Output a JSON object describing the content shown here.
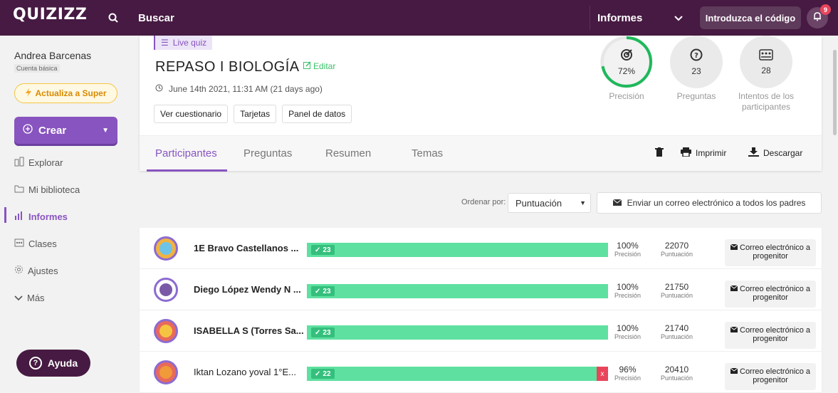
{
  "topbar": {
    "logo": "QUIZIZZ",
    "search_label": "Buscar",
    "reports_label": "Informes",
    "enter_code_label": "Introduzca el código",
    "notification_count": "9"
  },
  "sidebar": {
    "user_name": "Andrea Barcenas",
    "user_plan": "Cuenta básica",
    "upgrade_label": "Actualiza a Super",
    "create_label": "Crear",
    "items": [
      {
        "label": "Explorar",
        "icon": "explore-icon"
      },
      {
        "label": "Mi biblioteca",
        "icon": "folder-icon"
      },
      {
        "label": "Informes",
        "icon": "reports-icon",
        "active": true
      },
      {
        "label": "Clases",
        "icon": "classes-icon"
      },
      {
        "label": "Ajustes",
        "icon": "settings-icon"
      },
      {
        "label": "Más",
        "icon": "chevron-down-icon"
      }
    ],
    "help_label": "Ayuda"
  },
  "quiz": {
    "type_label": "Live quiz",
    "title": "REPASO I BIOLOGÍA",
    "edit_label": "Editar",
    "date": "June 14th 2021, 11:31 AM (21 days ago)",
    "buttons": [
      "Ver cuestionario",
      "Tarjetas",
      "Panel de datos"
    ],
    "stats": {
      "accuracy_value": "72%",
      "accuracy_label": "Precisión",
      "accuracy_fraction": 0.72,
      "questions_value": "23",
      "questions_label": "Preguntas",
      "attempts_value": "28",
      "attempts_label": "Intentos de los participantes"
    }
  },
  "tabs": {
    "participants": "Participantes",
    "questions": "Preguntas",
    "summary": "Resumen",
    "topics": "Temas",
    "print": "Imprimir",
    "download": "Descargar"
  },
  "toolbar": {
    "sort_label": "Ordenar por:",
    "sort_value": "Puntuación",
    "email_all_label": "Enviar un correo electrónico a todos los padres"
  },
  "participants": [
    {
      "name": "1E Bravo Castellanos ...",
      "correct": "23",
      "accuracy": "100%",
      "accuracy_label": "Precisión",
      "score": "22070",
      "score_label": "Puntuación",
      "email_label": "Correo electrónico a progenitor",
      "wrong": ""
    },
    {
      "name": "Diego López Wendy N ...",
      "correct": "23",
      "accuracy": "100%",
      "accuracy_label": "Precisión",
      "score": "21750",
      "score_label": "Puntuación",
      "email_label": "Correo electrónico a progenitor",
      "wrong": ""
    },
    {
      "name": "ISABELLA S (Torres Sa...",
      "correct": "23",
      "accuracy": "100%",
      "accuracy_label": "Precisión",
      "score": "21740",
      "score_label": "Puntuación",
      "email_label": "Correo electrónico a progenitor",
      "wrong": ""
    },
    {
      "name": "Iktan Lozano yoval 1°E...",
      "correct": "22",
      "accuracy": "96%",
      "accuracy_label": "Precisión",
      "score": "20410",
      "score_label": "Puntuación",
      "email_label": "Correo electrónico a progenitor",
      "wrong": "x"
    }
  ],
  "colors": {
    "brand": "#461a42",
    "accent": "#8854c0",
    "correct": "#5ee0a0",
    "wrong": "#e8455b"
  }
}
